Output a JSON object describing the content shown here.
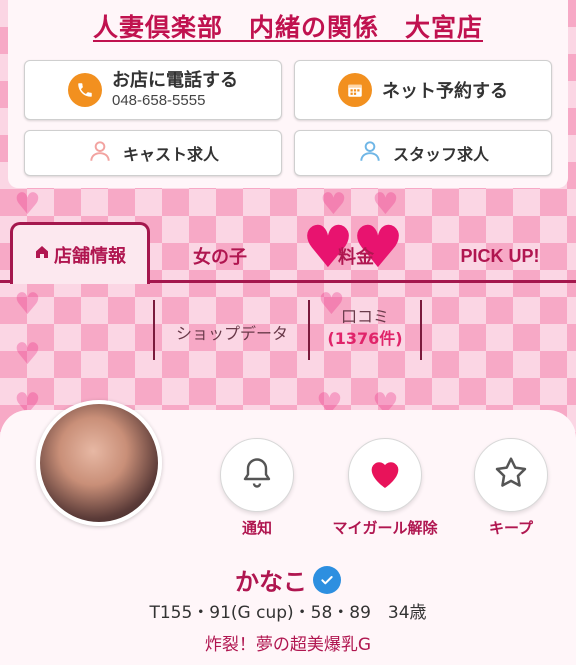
{
  "header": {
    "shop_title": "人妻倶楽部　内緒の関係　大宮店"
  },
  "buttons": {
    "phone": {
      "label": "お店に電話する",
      "number": "048-658-5555",
      "icon": "phone-icon"
    },
    "reserve": {
      "label": "ネット予約する",
      "icon": "calendar-icon"
    },
    "cast_recruit": {
      "label": "キャスト求人",
      "icon": "person-icon"
    },
    "staff_recruit": {
      "label": "スタッフ求人",
      "icon": "person-icon"
    }
  },
  "tabs": [
    {
      "label": "店舗情報",
      "icon": "home-icon",
      "active": true
    },
    {
      "label": "女の子",
      "active": false
    },
    {
      "label": "料金",
      "active": false
    },
    {
      "label": "PICK UP!",
      "active": false
    }
  ],
  "subtabs": {
    "shop_data": "ショップデータ",
    "reviews": "口コミ",
    "review_count": "(1376件)"
  },
  "profile": {
    "name": "かなこ",
    "stats": "T155・91(G cup)・58・89　34歳",
    "catchphrase": "炸裂！夢の超美爆乳G",
    "actions": [
      {
        "label": "通知",
        "icon": "bell-icon"
      },
      {
        "label": "マイガール解除",
        "icon": "heart-icon"
      },
      {
        "label": "キープ",
        "icon": "star-icon"
      }
    ]
  },
  "colors": {
    "brand": "#b01650",
    "accent_orange": "#f2901f",
    "verified_blue": "#2d8fe0",
    "heart_red": "#e8136f"
  }
}
